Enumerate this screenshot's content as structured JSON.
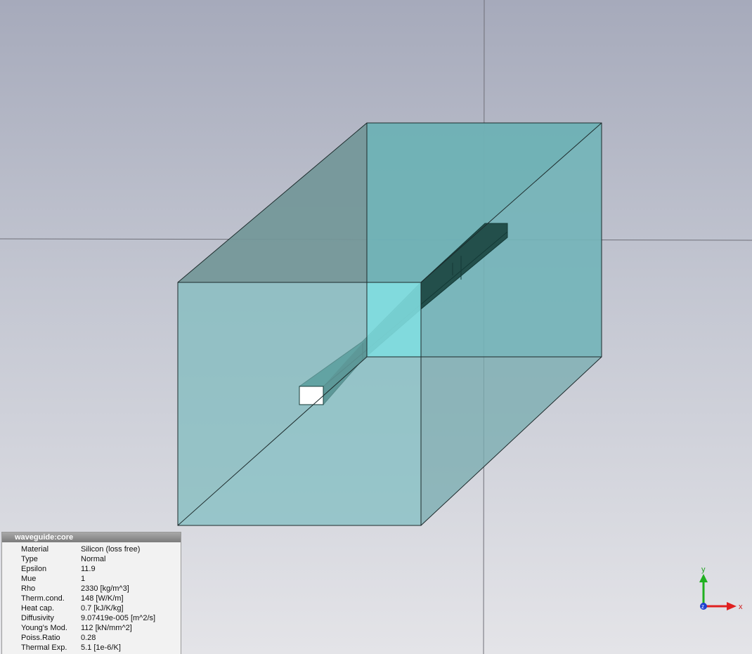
{
  "app": {
    "view": "3d-viewport"
  },
  "properties": {
    "title": "waveguide:core",
    "rows": [
      {
        "key": "Material",
        "value": "Silicon (loss free)"
      },
      {
        "key": "Type",
        "value": "Normal"
      },
      {
        "key": "Epsilon",
        "value": "11.9"
      },
      {
        "key": "Mue",
        "value": "1"
      },
      {
        "key": "Rho",
        "value": "2330 [kg/m^3]"
      },
      {
        "key": "Therm.cond.",
        "value": "148 [W/K/m]"
      },
      {
        "key": "Heat cap.",
        "value": "0.7 [kJ/K/kg]"
      },
      {
        "key": "Diffusivity",
        "value": "9.07419e-005 [m^2/s]"
      },
      {
        "key": "Young's Mod.",
        "value": "112 [kN/mm^2]"
      },
      {
        "key": "Poiss.Ratio",
        "value": "0.28"
      },
      {
        "key": "Thermal Exp.",
        "value": "5.1 [1e-6/K]"
      }
    ]
  },
  "axes": {
    "y": "y",
    "x": "x",
    "z": "z"
  },
  "colors": {
    "background_top": "#a6aabb",
    "background_bottom": "#e4e4e8",
    "box_fill": "#7fc3c6",
    "core_fill": "#1f5f5a",
    "port_fill": "#ffffff",
    "axis_x": "#e02020",
    "axis_y": "#20b020",
    "axis_z": "#2040d0"
  }
}
